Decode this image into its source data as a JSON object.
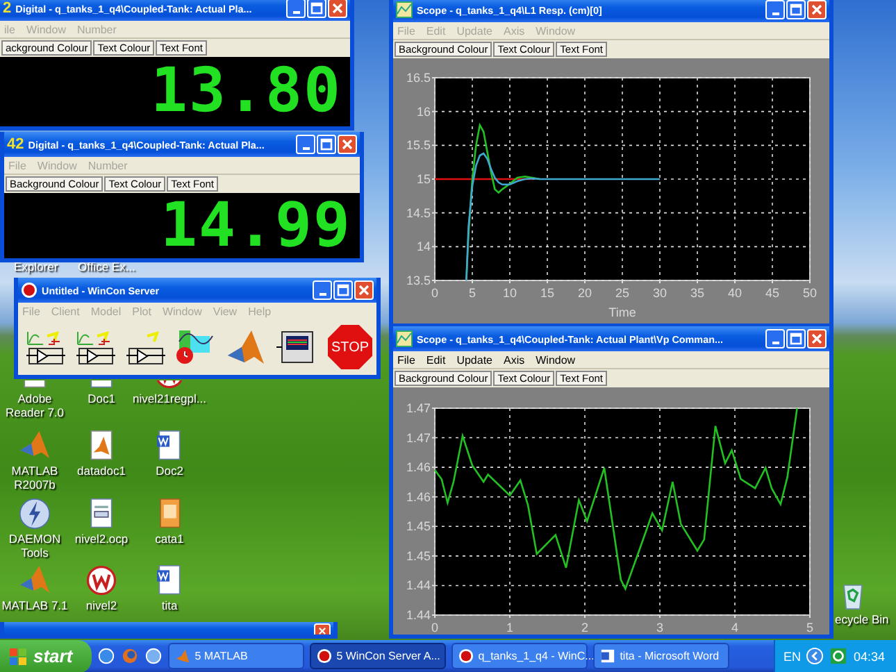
{
  "digital_windows": [
    {
      "icon_text": "2",
      "title": "Digital - q_tanks_1_q4\\Coupled-Tank: Actual Pla...",
      "menu": [
        "ile",
        "Window",
        "Number"
      ],
      "menu_disabled": true,
      "toolbar": [
        "ackground Colour",
        "Text Colour",
        "Text Font"
      ],
      "value": "13.80"
    },
    {
      "icon_text": "42",
      "title": "Digital - q_tanks_1_q4\\Coupled-Tank: Actual Pla...",
      "menu": [
        "File",
        "Window",
        "Number"
      ],
      "menu_disabled": true,
      "toolbar": [
        "Background Colour",
        "Text Colour",
        "Text Font"
      ],
      "value": "14.99"
    }
  ],
  "desktop_labels": [
    "Explorer",
    "Office Ex..."
  ],
  "wincon": {
    "title": "Untitled - WinCon Server",
    "menu": [
      "File",
      "Client",
      "Model",
      "Plot",
      "Window",
      "View",
      "Help"
    ],
    "menu_disabled": true,
    "stop_label": "STOP"
  },
  "desktop_icons": [
    {
      "label": "Adobe Reader 7.0",
      "kind": "pdf"
    },
    {
      "label": "Doc1",
      "kind": "doc"
    },
    {
      "label": "nivel21regpl...",
      "kind": "wincon"
    },
    {
      "label": "MATLAB R2007b",
      "kind": "matlab"
    },
    {
      "label": "datadoc1",
      "kind": "matlabdoc"
    },
    {
      "label": "Doc2",
      "kind": "word"
    },
    {
      "label": "DAEMON Tools",
      "kind": "daemon"
    },
    {
      "label": "nivel2.ocp",
      "kind": "file"
    },
    {
      "label": "cata1",
      "kind": "image"
    },
    {
      "label": "MATLAB 7.1",
      "kind": "matlab"
    },
    {
      "label": "nivel2",
      "kind": "wincon"
    },
    {
      "label": "tita",
      "kind": "word"
    }
  ],
  "recycle_bin": {
    "label": "ecycle Bin"
  },
  "scopes": [
    {
      "title": "Scope - q_tanks_1_q4\\L1 Resp. (cm)[0]",
      "menu": [
        "File",
        "Edit",
        "Update",
        "Axis",
        "Window"
      ],
      "menu_disabled": true,
      "toolbar": [
        "Background Colour",
        "Text Colour",
        "Text Font"
      ],
      "chart_data": {
        "type": "line",
        "xlabel": "Time",
        "x": [
          0,
          4.2,
          4.5,
          5,
          5.5,
          6,
          6.5,
          7,
          7.5,
          8,
          8.5,
          9,
          10,
          11,
          12,
          13,
          14,
          15,
          20,
          25,
          30
        ],
        "series": [
          {
            "color": "#e01010",
            "values": [
              15,
              15,
              15,
              15,
              15,
              15,
              15,
              15,
              15,
              15,
              15,
              15,
              15,
              15,
              15,
              15,
              null,
              null,
              null,
              null,
              null
            ]
          },
          {
            "color": "#22c022",
            "values": [
              null,
              13.5,
              14.2,
              15.0,
              15.5,
              15.8,
              15.7,
              15.4,
              15.1,
              14.85,
              14.8,
              14.85,
              14.93,
              15.02,
              15.04,
              15.02,
              15.0,
              null,
              null,
              null,
              null
            ]
          },
          {
            "color": "#40a8d0",
            "values": [
              null,
              13.5,
              14.3,
              14.9,
              15.2,
              15.35,
              15.38,
              15.3,
              15.15,
              15.02,
              14.95,
              14.92,
              14.92,
              14.97,
              15.0,
              15.01,
              15.0,
              15.0,
              15.0,
              15.0,
              15.0
            ]
          }
        ],
        "grid": true,
        "xlim": [
          0,
          50
        ],
        "ylim": [
          13.5,
          16.5
        ],
        "xticks": [
          0,
          5,
          10,
          15,
          20,
          25,
          30,
          35,
          40,
          45,
          50
        ],
        "yticks": [
          13.5,
          14,
          14.5,
          15,
          15.5,
          16,
          16.5
        ]
      }
    },
    {
      "title": "Scope - q_tanks_1_q4\\Coupled-Tank: Actual Plant\\Vp Comman...",
      "menu": [
        "File",
        "Edit",
        "Update",
        "Axis",
        "Window"
      ],
      "menu_disabled": false,
      "toolbar": [
        "Background Colour",
        "Text Colour",
        "Text Font"
      ],
      "chart_data": {
        "type": "line",
        "x": [
          0,
          0.09,
          0.17,
          0.25,
          0.37,
          0.5,
          0.65,
          0.71,
          1.0,
          1.14,
          1.24,
          1.36,
          1.61,
          1.75,
          1.92,
          2.03,
          2.26,
          2.48,
          2.54,
          2.72,
          2.9,
          3.03,
          3.17,
          3.28,
          3.5,
          3.59,
          3.74,
          3.87,
          3.96,
          4.08,
          4.27,
          4.41,
          4.49,
          4.61,
          4.7,
          4.83
        ],
        "series": [
          {
            "color": "#22c022",
            "values": [
              1.4601,
              1.4587,
              1.4551,
              1.4583,
              1.4653,
              1.4608,
              1.4583,
              1.4594,
              1.4562,
              1.4585,
              1.4548,
              1.4473,
              1.4502,
              1.4452,
              1.4555,
              1.4523,
              1.4604,
              1.4434,
              1.442,
              1.4477,
              1.4535,
              1.4509,
              1.4583,
              1.4519,
              1.4478,
              1.4495,
              1.4668,
              1.4611,
              1.4631,
              1.4587,
              1.4573,
              1.4604,
              1.4573,
              1.4549,
              1.459,
              1.4695
            ]
          }
        ],
        "grid": true,
        "xlim": [
          0,
          5
        ],
        "ylim": [
          1.438,
          1.4695
        ],
        "xticks": [
          0,
          1,
          2,
          3,
          4,
          5
        ],
        "yticks": [
          {
            "value": 1.438,
            "label": "1.44"
          },
          {
            "value": 1.4425,
            "label": "1.44"
          },
          {
            "value": 1.447,
            "label": "1.45"
          },
          {
            "value": 1.4515,
            "label": "1.45"
          },
          {
            "value": 1.456,
            "label": "1.46"
          },
          {
            "value": 1.4605,
            "label": "1.46"
          },
          {
            "value": 1.465,
            "label": "1.47"
          },
          {
            "value": 1.4695,
            "label": "1.47"
          }
        ]
      }
    }
  ],
  "taskbar": {
    "start_label": "start",
    "tasks": [
      {
        "label": "5 MATLAB",
        "kind": "matlab",
        "selected": false
      },
      {
        "label": "5 WinCon Server A...",
        "kind": "wincon",
        "selected": true
      },
      {
        "label": "q_tanks_1_q4 - WinC...",
        "kind": "wincon",
        "selected": false
      },
      {
        "label": "tita - Microsoft Word",
        "kind": "word",
        "selected": false
      }
    ],
    "language": "EN",
    "clock": "04:34"
  }
}
